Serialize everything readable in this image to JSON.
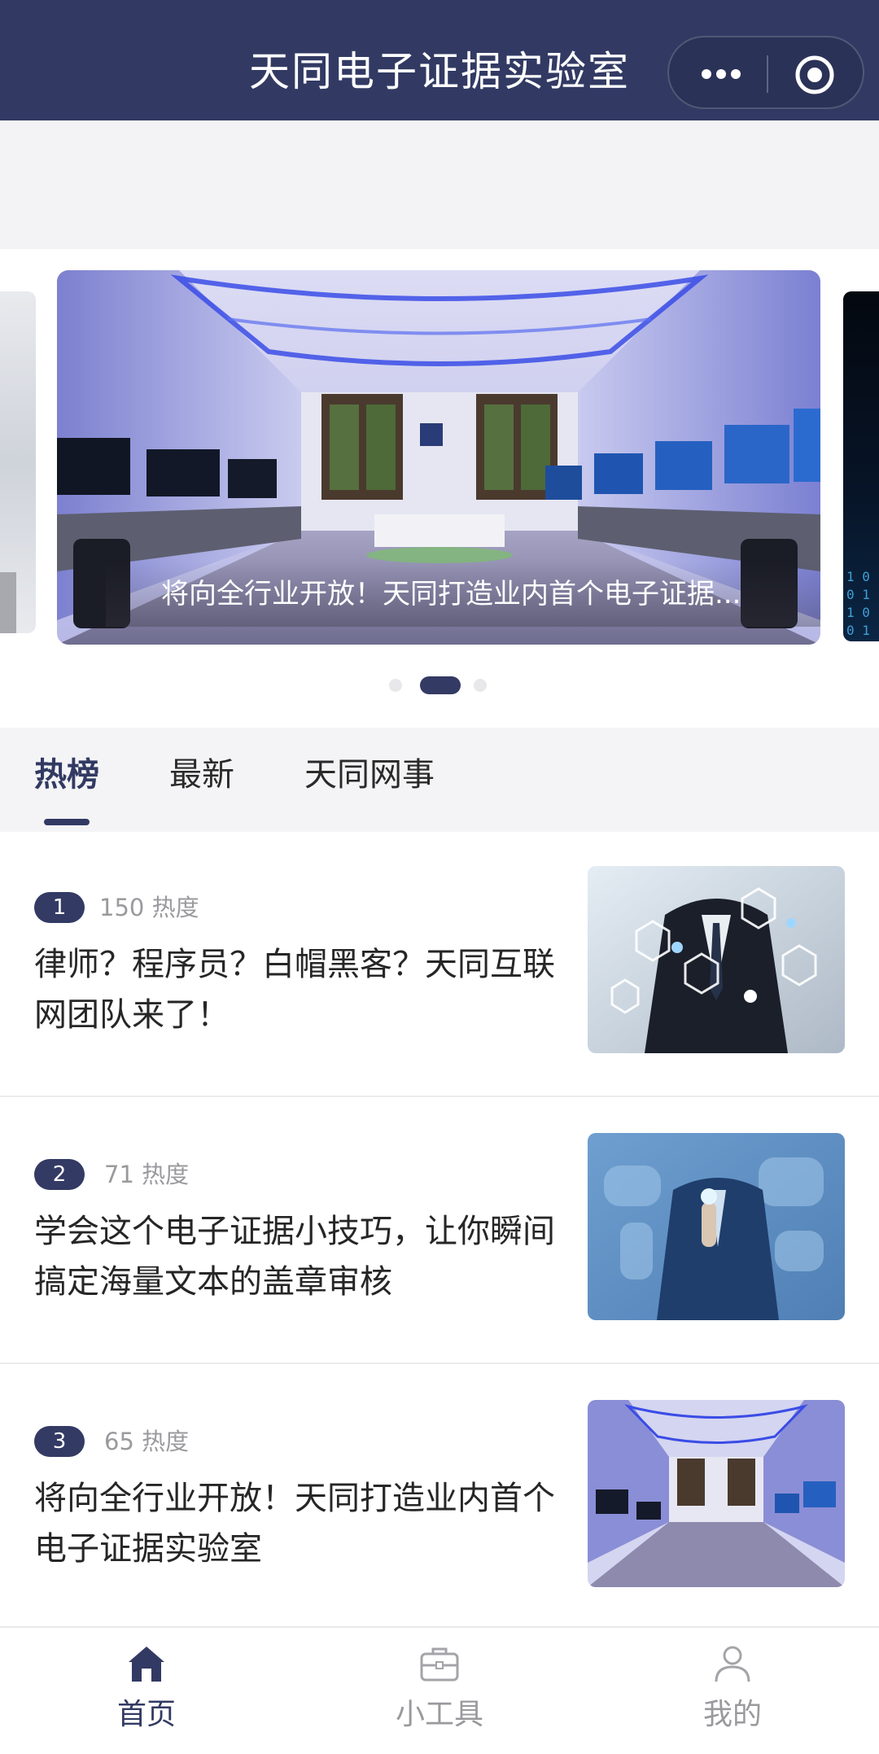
{
  "header": {
    "title": "天同电子证据实验室",
    "more_icon": "more-dots-icon",
    "close_icon": "target-circle-icon"
  },
  "carousel": {
    "caption": "将向全行业开放！天同打造业内首个电子证据...",
    "slide_count": 3,
    "active_index": 1
  },
  "tabs": [
    {
      "label": "热榜",
      "active": true
    },
    {
      "label": "最新",
      "active": false
    },
    {
      "label": "天同网事",
      "active": false
    }
  ],
  "feed": [
    {
      "rank": "1",
      "heat": "150 热度",
      "title": "律师？程序员？白帽黑客？天同互联网团队来了！"
    },
    {
      "rank": "2",
      "heat": "71 热度",
      "title": "学会这个电子证据小技巧，让你瞬间搞定海量文本的盖章审核"
    },
    {
      "rank": "3",
      "heat": "65 热度",
      "title": "将向全行业开放！天同打造业内首个电子证据实验室"
    }
  ],
  "bottom_nav": [
    {
      "label": "首页",
      "icon": "home-icon",
      "active": true
    },
    {
      "label": "小工具",
      "icon": "toolbox-icon",
      "active": false
    },
    {
      "label": "我的",
      "icon": "person-icon",
      "active": false
    }
  ],
  "colors": {
    "brand_navy": "#323a63",
    "inactive_gray": "#9a9a9e"
  }
}
